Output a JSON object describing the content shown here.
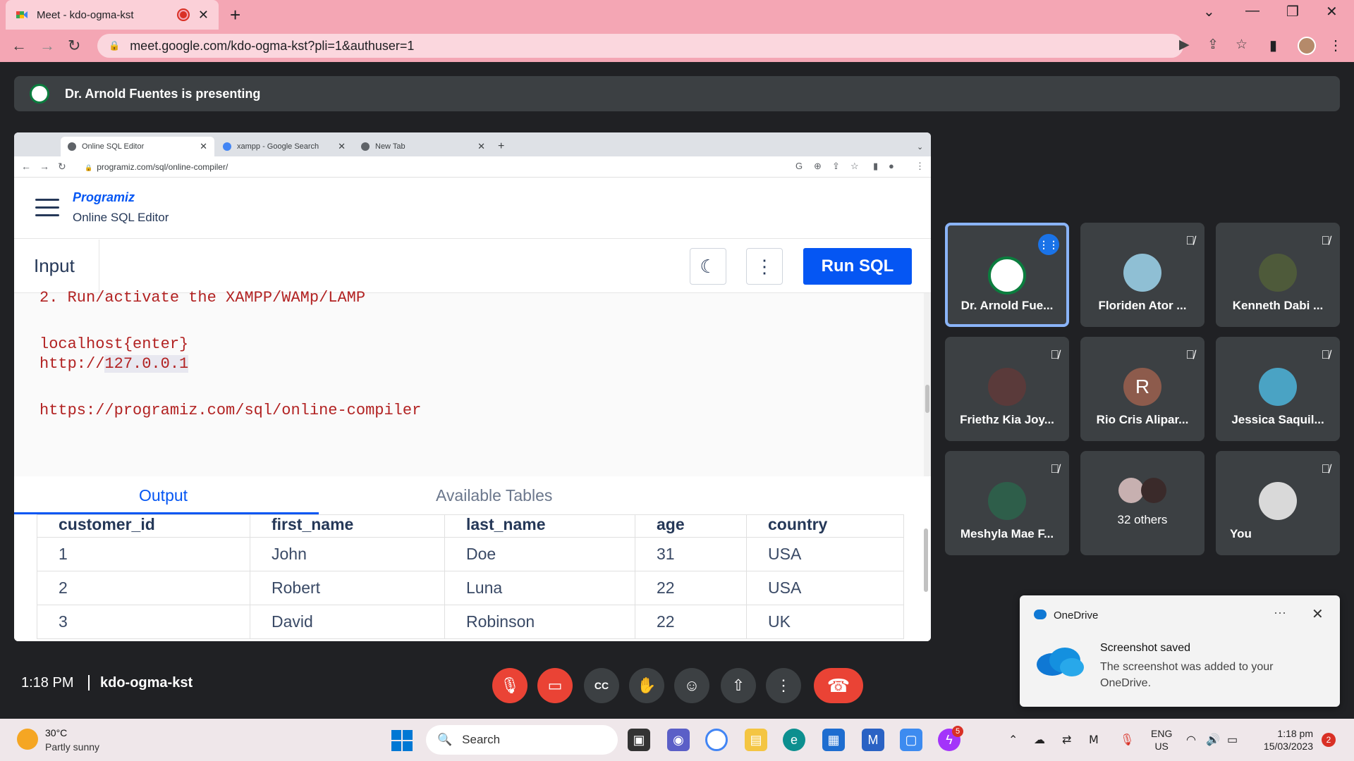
{
  "chrome": {
    "tab_title": "Meet - kdo-ogma-kst",
    "url": "meet.google.com/kdo-ogma-kst?pli=1&authuser=1"
  },
  "meet": {
    "presenting_banner": "Dr. Arnold Fuentes is presenting",
    "time": "1:18 PM",
    "meeting_code": "kdo-ogma-kst"
  },
  "shared_screen": {
    "tabs": [
      {
        "label": "Online SQL Editor"
      },
      {
        "label": "xampp - Google Search"
      },
      {
        "label": "New Tab"
      }
    ],
    "url": "programiz.com/sql/online-compiler/",
    "logo": "Programiz",
    "subtitle": "Online SQL Editor",
    "input_label": "Input",
    "run_button": "Run SQL",
    "code_lines": [
      "2. Run/activate the XAMPP/WAMp/LAMP",
      "localhost{enter}",
      "http://",
      "127.0.0.1",
      "https://programiz.com/sql/online-compiler"
    ],
    "output_tabs": [
      "Output",
      "Available Tables"
    ],
    "table": {
      "headers": [
        "customer_id",
        "first_name",
        "last_name",
        "age",
        "country"
      ],
      "rows": [
        [
          "1",
          "John",
          "Doe",
          "31",
          "USA"
        ],
        [
          "2",
          "Robert",
          "Luna",
          "22",
          "USA"
        ],
        [
          "3",
          "David",
          "Robinson",
          "22",
          "UK"
        ]
      ]
    }
  },
  "participants": [
    {
      "name": "Dr. Arnold Fue...",
      "color": "#0b7d3e"
    },
    {
      "name": "Floriden Ator ...",
      "color": "#8fbfd4"
    },
    {
      "name": "Kenneth Dabi ...",
      "color": "#4e5a3a"
    },
    {
      "name": "Friethz Kia Joy...",
      "color": "#5a3a3a"
    },
    {
      "name": "Rio Cris Alipar...",
      "initial": "R",
      "color": "#8d5b4c"
    },
    {
      "name": "Jessica Saquil...",
      "color": "#4aa3c4"
    },
    {
      "name": "Meshyla Mae F...",
      "color": "#2e5e4a"
    },
    {
      "name": "32 others",
      "color": "#c7b0b0"
    },
    {
      "name": "You",
      "color": "#d9d9d9"
    }
  ],
  "toast": {
    "app": "OneDrive",
    "title": "Screenshot saved",
    "body": "The screenshot was added to your OneDrive."
  },
  "taskbar": {
    "temp": "30°C",
    "weather": "Partly sunny",
    "search": "Search",
    "messenger_badge": "5",
    "lang_1": "ENG",
    "lang_2": "US",
    "time": "1:18 pm",
    "date": "15/03/2023",
    "notif_count": "2"
  }
}
